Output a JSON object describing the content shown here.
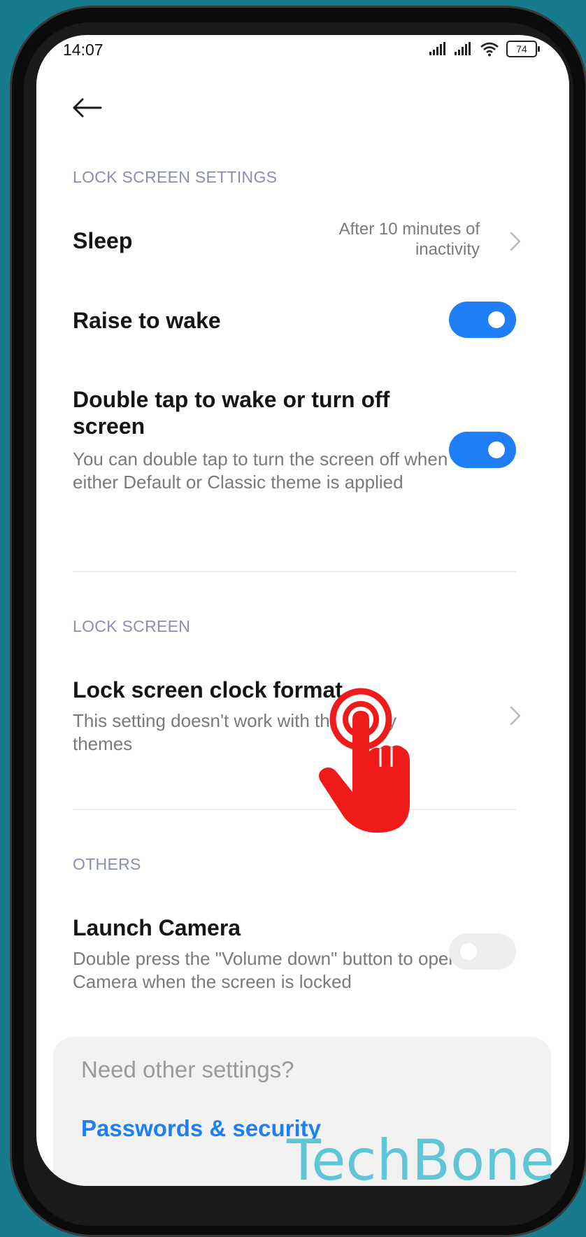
{
  "status_bar": {
    "time": "14:07",
    "battery": "74",
    "icons": [
      "signal-icon",
      "signal-icon",
      "wifi-icon",
      "battery-icon"
    ]
  },
  "header": {
    "back_icon": "arrow-left-icon"
  },
  "sections": {
    "lock_screen_settings": {
      "header": "LOCK SCREEN SETTINGS",
      "sleep": {
        "title": "Sleep",
        "value": "After 10 minutes of inactivity"
      },
      "raise_to_wake": {
        "title": "Raise to wake",
        "enabled": true
      },
      "double_tap": {
        "title": "Double tap to wake or turn off screen",
        "subtitle": "You can double tap to turn the screen off when either Default or Classic theme is applied",
        "enabled": true
      }
    },
    "lock_screen": {
      "header": "LOCK SCREEN",
      "clock_format": {
        "title": "Lock screen clock format",
        "subtitle": "This setting doesn't work with third-party themes"
      }
    },
    "others": {
      "header": "OTHERS",
      "launch_camera": {
        "title": "Launch Camera",
        "subtitle": "Double press the \"Volume down\" button to open Camera when the screen is locked",
        "enabled": false
      }
    }
  },
  "suggestions": {
    "title": "Need other settings?",
    "link": "Passwords & security"
  },
  "overlay": {
    "hand_icon": "tap-hand-icon",
    "watermark": "TechBone"
  },
  "colors": {
    "accent": "#1d7ef5",
    "background": "#167c8d",
    "section_header": "#8a8fb0",
    "hand": "#f01a1a",
    "watermark": "#5fc6d6"
  }
}
